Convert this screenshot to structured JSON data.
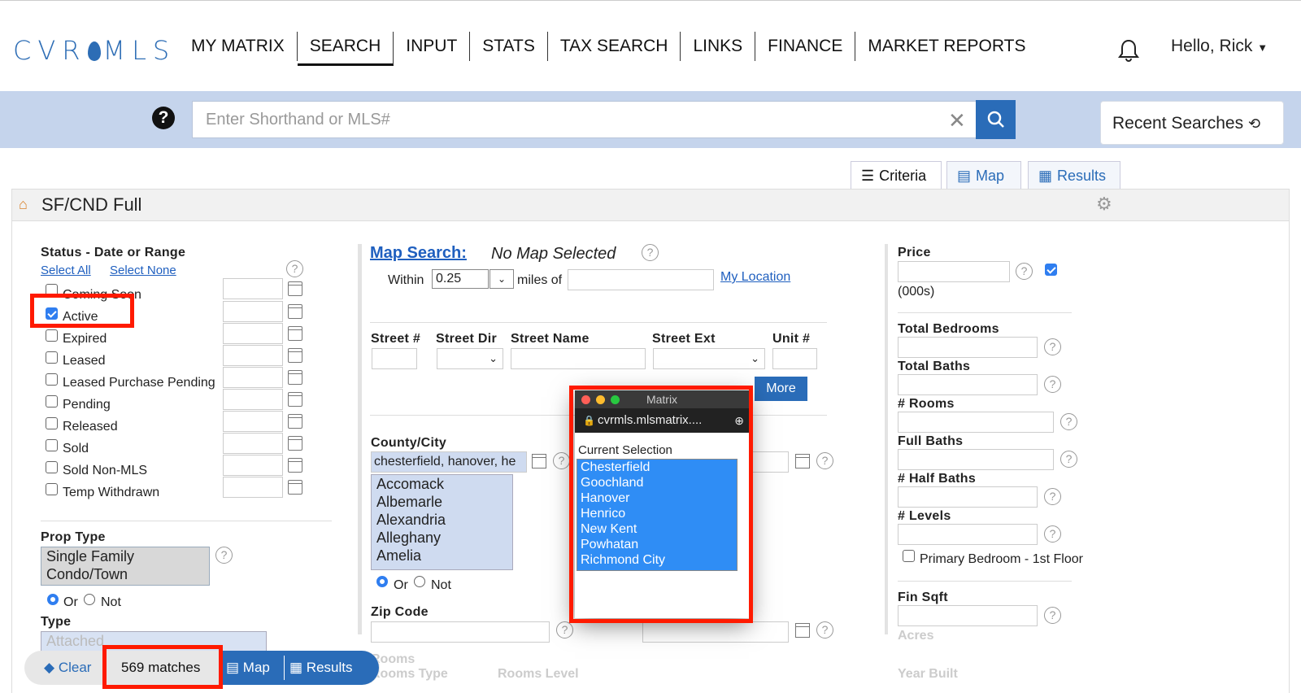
{
  "app": {
    "logo": "CVRMLS",
    "greeting": "Hello, Rick"
  },
  "nav": {
    "items": [
      "MY MATRIX",
      "SEARCH",
      "INPUT",
      "STATS",
      "TAX SEARCH",
      "LINKS",
      "FINANCE",
      "MARKET REPORTS"
    ],
    "active": "SEARCH"
  },
  "search": {
    "placeholder": "Enter Shorthand or MLS#",
    "recent_label": "Recent Searches"
  },
  "tabs": {
    "criteria": "Criteria",
    "map": "Map",
    "results": "Results"
  },
  "form_title": "SF/CND Full",
  "status": {
    "label": "Status - Date or Range",
    "select_all": "Select All",
    "select_none": "Select None",
    "options": [
      {
        "label": "Coming Soon",
        "checked": false
      },
      {
        "label": "Active",
        "checked": true
      },
      {
        "label": "Expired",
        "checked": false
      },
      {
        "label": "Leased",
        "checked": false
      },
      {
        "label": "Leased Purchase Pending",
        "checked": false
      },
      {
        "label": "Pending",
        "checked": false
      },
      {
        "label": "Released",
        "checked": false
      },
      {
        "label": "Sold",
        "checked": false
      },
      {
        "label": "Sold Non-MLS",
        "checked": false
      },
      {
        "label": "Temp Withdrawn",
        "checked": false
      }
    ]
  },
  "prop_type": {
    "label": "Prop Type",
    "options": [
      "Single Family",
      "Condo/Town"
    ],
    "or": "Or",
    "not": "Not"
  },
  "type": {
    "label": "Type",
    "value": "Attached"
  },
  "map_search": {
    "link": "Map Search:",
    "status": "No Map Selected",
    "within": "Within",
    "distance": "0.25",
    "miles_of": "miles of",
    "my_location": "My Location"
  },
  "street": {
    "num": "Street #",
    "dir": "Street Dir",
    "name": "Street Name",
    "ext": "Street Ext",
    "unit": "Unit #",
    "more": "More"
  },
  "county": {
    "label": "County/City",
    "value": "chesterfield, hanover, he",
    "list": [
      "Accomack",
      "Albemarle",
      "Alexandria",
      "Alleghany",
      "Amelia"
    ],
    "or": "Or",
    "not": "Not"
  },
  "zip": {
    "label": "Zip Code"
  },
  "rooms": {
    "label": "Rooms",
    "type": "Rooms Type",
    "level": "Rooms Level"
  },
  "popup": {
    "title": "Matrix",
    "url": "cvrmls.mlsmatrix....",
    "current": "Current Selection",
    "items": [
      "Chesterfield",
      "Goochland",
      "Hanover",
      "Henrico",
      "New Kent",
      "Powhatan",
      "Richmond City"
    ]
  },
  "right": {
    "price": "Price",
    "price_unit": "(000s)",
    "fields": [
      "Total Bedrooms",
      "Total Baths",
      "# Rooms",
      "Full Baths",
      "# Half Baths",
      "# Levels"
    ],
    "primary_bed": "Primary Bedroom - 1st Floor",
    "fin_sqft": "Fin Sqft",
    "acres": "Acres",
    "year_built": "Year Built"
  },
  "bottom": {
    "clear": "Clear",
    "matches": "569 matches",
    "map": "Map",
    "results": "Results"
  }
}
